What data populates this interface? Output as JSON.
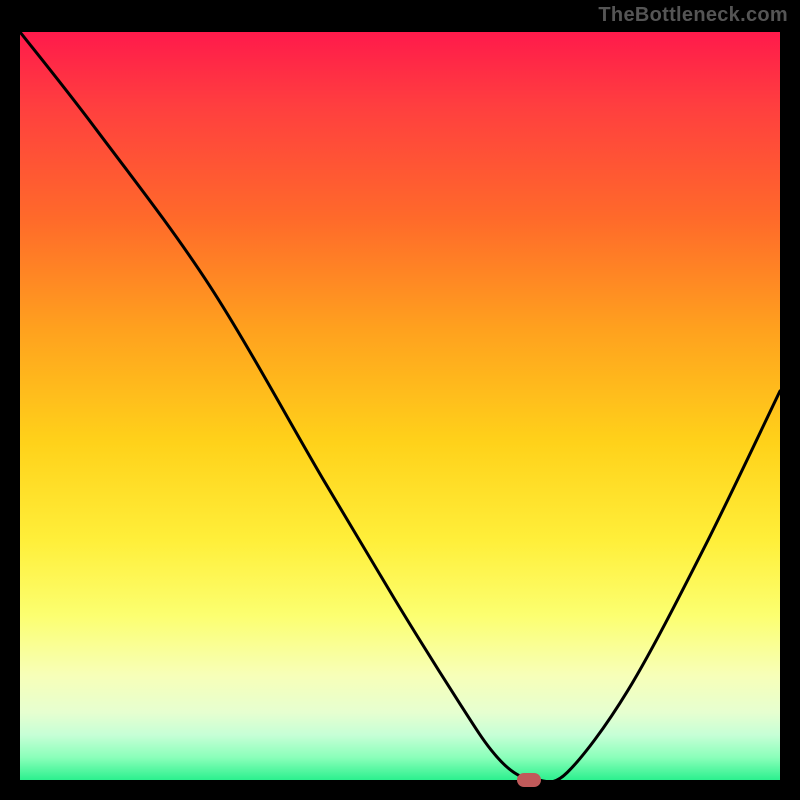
{
  "watermark": "TheBottleneck.com",
  "colors": {
    "frame": "#000000",
    "curve": "#000000",
    "marker": "#c05a5a",
    "gradient_top": "#ff1a4b",
    "gradient_bottom": "#2cf08e"
  },
  "chart_data": {
    "type": "line",
    "title": "",
    "xlabel": "",
    "ylabel": "",
    "xlim": [
      0,
      100
    ],
    "ylim": [
      0,
      100
    ],
    "series": [
      {
        "name": "bottleneck-curve",
        "x": [
          0,
          10,
          25,
          40,
          50,
          58,
          62,
          65,
          68,
          72,
          80,
          90,
          100
        ],
        "values": [
          100,
          87,
          66,
          40,
          23,
          10,
          4,
          1,
          0,
          1,
          12,
          31,
          52
        ]
      }
    ],
    "marker": {
      "x": 67,
      "y": 0
    },
    "gradient_stops": [
      {
        "pos": 0,
        "color": "#ff1a4b"
      },
      {
        "pos": 10,
        "color": "#ff3f3f"
      },
      {
        "pos": 25,
        "color": "#ff6a2a"
      },
      {
        "pos": 40,
        "color": "#ffa21e"
      },
      {
        "pos": 55,
        "color": "#ffd21a"
      },
      {
        "pos": 68,
        "color": "#ffef3a"
      },
      {
        "pos": 78,
        "color": "#fcff70"
      },
      {
        "pos": 86,
        "color": "#f7ffb8"
      },
      {
        "pos": 91,
        "color": "#e6ffd0"
      },
      {
        "pos": 94,
        "color": "#c6ffd6"
      },
      {
        "pos": 97,
        "color": "#8affba"
      },
      {
        "pos": 100,
        "color": "#2cf08e"
      }
    ]
  }
}
